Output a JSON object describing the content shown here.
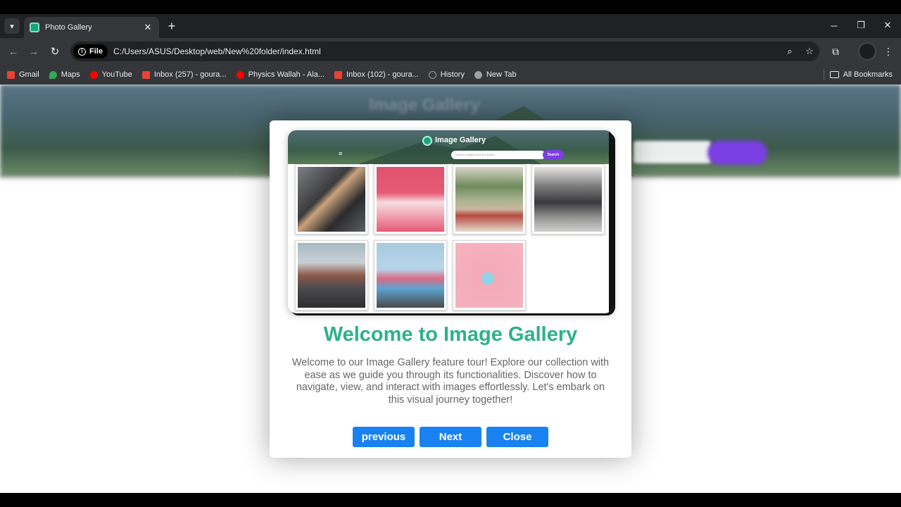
{
  "browser": {
    "tab_title": "Photo Gallery",
    "new_tab_glyph": "+",
    "address": {
      "security_chip": "File",
      "url": "C:/Users/ASUS/Desktop/web/New%20folder/index.html"
    },
    "bookmarks": [
      {
        "label": "Gmail",
        "color": "#ea4335"
      },
      {
        "label": "Maps",
        "color": "#34a853"
      },
      {
        "label": "YouTube",
        "color": "#ff0000"
      },
      {
        "label": "Inbox (257) - goura...",
        "color": "#ea4335"
      },
      {
        "label": "Physics Wallah - Ala...",
        "color": "#ff0000"
      },
      {
        "label": "Inbox (102) - goura...",
        "color": "#ea4335"
      },
      {
        "label": "History",
        "color": "#9aa0a6"
      },
      {
        "label": "New Tab",
        "color": "#9aa0a6"
      }
    ],
    "all_bookmarks": "All Bookmarks"
  },
  "modal": {
    "preview": {
      "title": "Image Gallery",
      "search_placeholder": "Search images from the library",
      "search_button": "Search",
      "menu_icon": "≡"
    },
    "title": "Welcome to Image Gallery",
    "text": "Welcome to our Image Gallery feature tour! Explore our collection with ease as we guide you through its functionalities. Discover how to navigate, view, and interact with images effortlessly. Let's embark on this visual journey together!",
    "buttons": {
      "previous": "previous",
      "next": "Next",
      "close": "Close"
    }
  },
  "colors": {
    "accent_title": "#2db18a",
    "button": "#1a82f0",
    "search_button": "#7b3fe4"
  }
}
